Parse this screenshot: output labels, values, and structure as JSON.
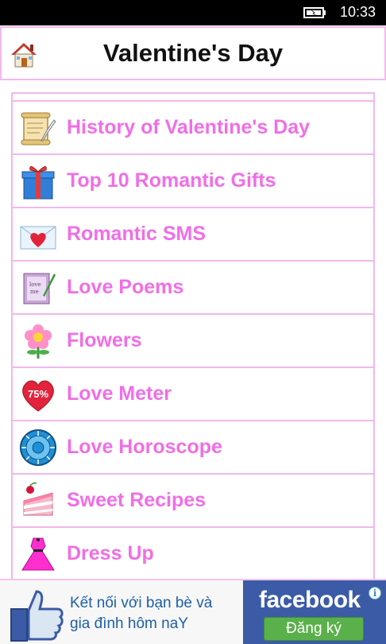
{
  "status_bar": {
    "time": "10:33",
    "battery_icon": "battery-charging-icon"
  },
  "header": {
    "title": "Valentine's Day",
    "home_icon": "home-icon"
  },
  "menu": {
    "items": [
      {
        "label": "History of Valentine's Day",
        "icon": "scroll-quill-icon"
      },
      {
        "label": "Top 10 Romantic Gifts",
        "icon": "gift-box-icon"
      },
      {
        "label": "Romantic SMS",
        "icon": "love-letter-icon"
      },
      {
        "label": "Love Poems",
        "icon": "poem-book-icon"
      },
      {
        "label": "Flowers",
        "icon": "pink-flower-icon"
      },
      {
        "label": "Love Meter",
        "icon": "heart-meter-icon",
        "badge": "75%"
      },
      {
        "label": "Love Horoscope",
        "icon": "zodiac-wheel-icon"
      },
      {
        "label": "Sweet Recipes",
        "icon": "cake-slice-icon"
      },
      {
        "label": "Dress Up",
        "icon": "pink-dress-icon"
      }
    ]
  },
  "ad": {
    "text_line1": "Kết nối với bạn bè và",
    "text_line2": "gia đình hôm naY",
    "brand": "facebook",
    "button_label": "Đăng ký",
    "info_glyph": "i",
    "colors": {
      "brand_blue": "#3b5ba7",
      "button_green": "#5ab04a"
    }
  },
  "colors": {
    "accent_pink": "#f06ee6",
    "border_pink": "#f2b8ec"
  }
}
